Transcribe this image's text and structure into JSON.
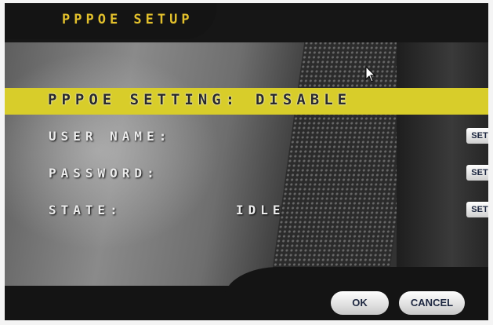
{
  "header": {
    "title": "PPPOE SETUP"
  },
  "pppoe_setting": {
    "label": "PPPOE SETTING:",
    "value": "DISABLE"
  },
  "rows": [
    {
      "label": "USER NAME:",
      "value": "",
      "button": "SET"
    },
    {
      "label": "PASSWORD:",
      "value": "",
      "button": "SET"
    },
    {
      "label": "STATE:",
      "value": "IDLE",
      "button": "SET"
    }
  ],
  "footer": {
    "ok_label": "OK",
    "cancel_label": "CANCEL"
  },
  "colors": {
    "accent": "#d8cd2a",
    "title": "#e2c02c",
    "background": "#1b1b1b"
  }
}
